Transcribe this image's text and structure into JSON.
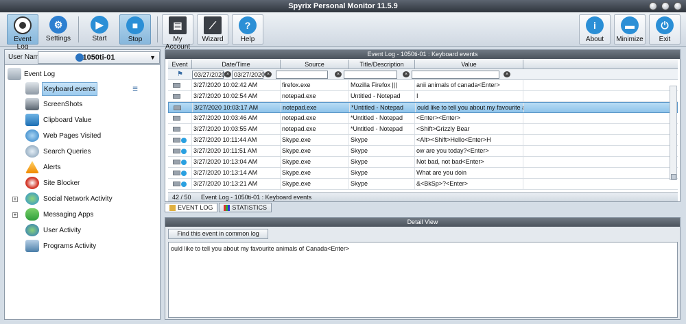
{
  "window": {
    "title": "Spyrix Personal Monitor 11.5.9"
  },
  "toolbar": {
    "event_log": "Event Log",
    "settings": "Settings",
    "start": "Start",
    "stop": "Stop",
    "my_account": "My Account",
    "wizard": "Wizard",
    "help": "Help",
    "about": "About",
    "minimize": "Minimize",
    "exit": "Exit"
  },
  "sidebar": {
    "user_name_label": "User Name",
    "user_value": "1050ti-01",
    "root": "Event Log",
    "items": [
      {
        "label": "Keyboard events"
      },
      {
        "label": "ScreenShots"
      },
      {
        "label": "Clipboard Value"
      },
      {
        "label": "Web Pages Visited"
      },
      {
        "label": "Search Queries"
      },
      {
        "label": "Alerts"
      },
      {
        "label": "Site Blocker"
      },
      {
        "label": "Social Network Activity"
      },
      {
        "label": "Messaging Apps"
      },
      {
        "label": "User Activity"
      },
      {
        "label": "Programs Activity"
      }
    ]
  },
  "log": {
    "panel_title": "Event Log - 1050ti-01 : Keyboard events",
    "columns": {
      "event": "Event",
      "datetime": "Date/Time",
      "source": "Source",
      "title": "Title/Description",
      "value": "Value"
    },
    "filter": {
      "date_from": "03/27/2020",
      "date_to": "03/27/2020"
    },
    "rows": [
      {
        "datetime": "3/27/2020 10:02:42 AM",
        "source": "firefox.exe",
        "title": "Mozilla Firefox |||",
        "value": "anii animals of canada<Enter>"
      },
      {
        "datetime": "3/27/2020 10:02:54 AM",
        "source": "notepad.exe",
        "title": "Untitled - Notepad",
        "value": "I"
      },
      {
        "datetime": "3/27/2020 10:03:17 AM",
        "source": "notepad.exe",
        "title": "*Untitled - Notepad",
        "value": "ould like to tell you about my favourite anim"
      },
      {
        "datetime": "3/27/2020 10:03:46 AM",
        "source": "notepad.exe",
        "title": "*Untitled - Notepad",
        "value": "<Enter><Enter>"
      },
      {
        "datetime": "3/27/2020 10:03:55 AM",
        "source": "notepad.exe",
        "title": "*Untitled - Notepad",
        "value": "<Shift>Grizzly Bear"
      },
      {
        "datetime": "3/27/2020 10:11:44 AM",
        "source": "Skype.exe",
        "title": "Skype",
        "value": "<Alt><Shift>Hello<Enter>H"
      },
      {
        "datetime": "3/27/2020 10:11:51 AM",
        "source": "Skype.exe",
        "title": "Skype",
        "value": "ow are you today?<Enter>"
      },
      {
        "datetime": "3/27/2020 10:13:04 AM",
        "source": "Skype.exe",
        "title": "Skype",
        "value": "Not bad, not bad<Enter>"
      },
      {
        "datetime": "3/27/2020 10:13:14 AM",
        "source": "Skype.exe",
        "title": "Skype",
        "value": "What are you doin"
      },
      {
        "datetime": "3/27/2020 10:13:21 AM",
        "source": "Skype.exe",
        "title": "Skype",
        "value": "&<BkSp>?<Enter>"
      }
    ],
    "status_count": "42 / 50",
    "status_text": "Event Log - 1050ti-01 : Keyboard events"
  },
  "tabs": {
    "event_log": "EVENT LOG",
    "statistics": "STATISTICS"
  },
  "detail": {
    "title": "Detail View",
    "find_button": "Find this event in common log",
    "text": "ould like to tell you about my favourite animals of Canada<Enter>"
  }
}
